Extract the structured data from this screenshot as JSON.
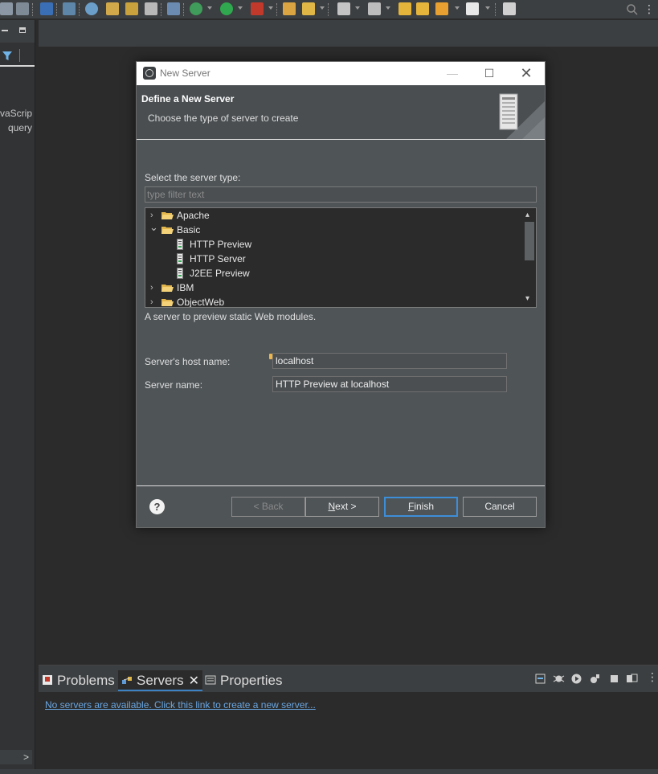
{
  "left_panel": {
    "items": [
      "avaScrip",
      "query"
    ],
    "scroll_arrow": ">"
  },
  "dialog": {
    "title": "New Server",
    "heading": "Define a New Server",
    "subheading": "Choose the type of server to create",
    "window_buttons": {
      "minimize": "—",
      "maximize": "☐",
      "close": "✕"
    },
    "select_label": "Select the server type:",
    "filter_placeholder": "type filter text",
    "tree": {
      "items": [
        {
          "label": "Apache",
          "twisty": "›"
        },
        {
          "label": "Basic",
          "twisty": "⌄"
        },
        {
          "label": "HTTP Preview"
        },
        {
          "label": "HTTP Server"
        },
        {
          "label": "J2EE Preview"
        },
        {
          "label": "IBM",
          "twisty": "›"
        },
        {
          "label": "ObjectWeb",
          "twisty": "›"
        }
      ],
      "scroll_up": "▴",
      "scroll_down": "▾"
    },
    "description": "A server to preview static Web modules.",
    "host_label": "Server's host name:",
    "host_value": "localhost",
    "name_label": "Server name:",
    "name_value": "HTTP Preview at localhost",
    "help": "?",
    "buttons": {
      "back": "< Back",
      "next_prefix": "N",
      "next_rest": "ext >",
      "finish_prefix": "F",
      "finish_rest": "inish",
      "cancel": "Cancel"
    }
  },
  "bottom_view": {
    "tabs": {
      "problems": "Problems",
      "servers": "Servers",
      "properties": "Properties"
    },
    "close": "✕",
    "more": "⋮",
    "link_text": "No servers are available. Click this link to create a new server..."
  },
  "toolbar": {
    "more": "⋮"
  },
  "colors": {
    "accent": "#3d8ed8",
    "link": "#6aa6e0",
    "dialog_bg": "#4f5457",
    "tree_bg": "#2b2b2b",
    "ide_bg": "#2b2b2b"
  }
}
